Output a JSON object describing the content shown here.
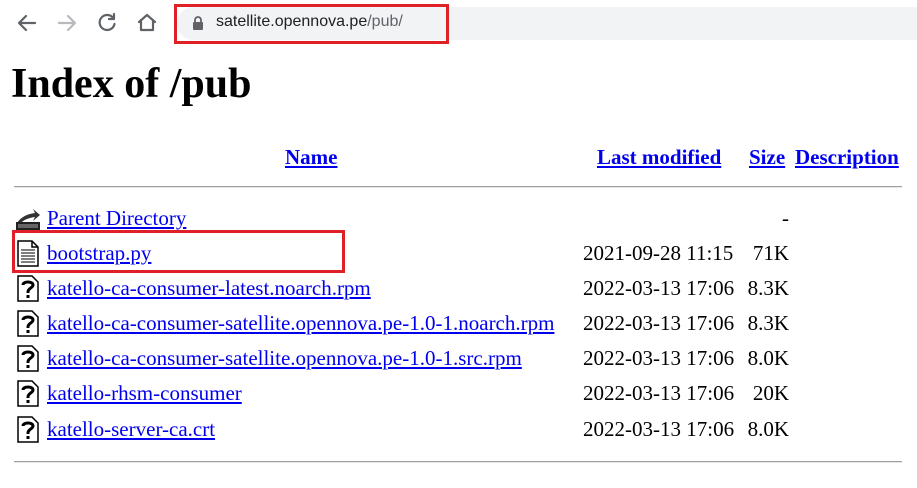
{
  "browser": {
    "url_host": "satellite.opennova.pe",
    "url_path": "/pub/"
  },
  "page": {
    "title": "Index of /pub"
  },
  "table": {
    "headers": {
      "name": "Name",
      "last_modified": "Last modified",
      "size": "Size",
      "description": "Description"
    },
    "rows": [
      {
        "name": "Parent Directory",
        "modified": "",
        "size": "-",
        "icon": "back-folder-icon"
      },
      {
        "name": "bootstrap.py",
        "modified": "2021-09-28 11:15",
        "size": "71K",
        "icon": "text-file-icon"
      },
      {
        "name": "katello-ca-consumer-latest.noarch.rpm",
        "modified": "2022-03-13 17:06",
        "size": "8.3K",
        "icon": "unknown-file-icon"
      },
      {
        "name": "katello-ca-consumer-satellite.opennova.pe-1.0-1.noarch.rpm",
        "modified": "2022-03-13 17:06",
        "size": "8.3K",
        "icon": "unknown-file-icon"
      },
      {
        "name": "katello-ca-consumer-satellite.opennova.pe-1.0-1.src.rpm",
        "modified": "2022-03-13 17:06",
        "size": "8.0K",
        "icon": "unknown-file-icon"
      },
      {
        "name": "katello-rhsm-consumer",
        "modified": "2022-03-13 17:06",
        "size": "20K",
        "icon": "unknown-file-icon"
      },
      {
        "name": "katello-server-ca.crt",
        "modified": "2022-03-13 17:06",
        "size": "8.0K",
        "icon": "unknown-file-icon"
      }
    ]
  },
  "colors": {
    "link": "#0000ee",
    "highlight": "#e02027"
  }
}
